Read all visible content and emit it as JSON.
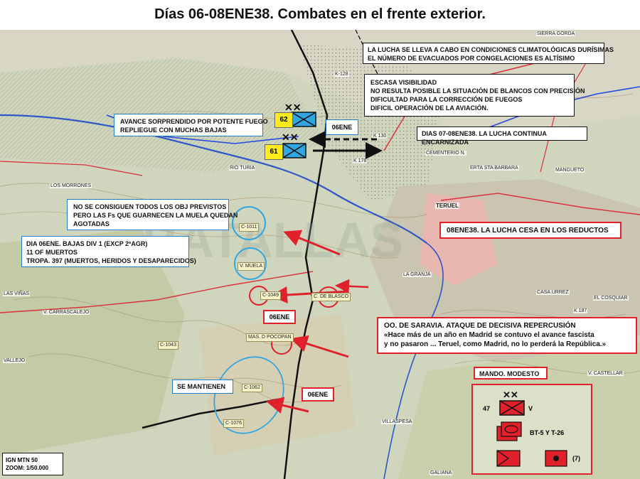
{
  "title": "Días 06-08ENE38. Combates en el frente exterior.",
  "boxes": {
    "climate": [
      "LA LUCHA SE LLEVA A CABO EN CONDICIONES CLIMATOLÓGICAS DURÍSIMAS",
      "EL NÚMERO DE EVACUADOS POR CONGELACIONES ES ALTÍSIMO"
    ],
    "visibility": [
      "ESCASA VISIBILIDAD",
      "NO RESULTA POSIBLE LA SITUACIÓN DE BLANCOS CON PRECISIÓN",
      "DIFICULTAD PARA LA CORRECCIÓN DE FUEGOS",
      "DIFICIL OPERACIÓN DE LA AVIACIÓN."
    ],
    "advance": [
      "AVANCE SORPRENDIDO POR POTENTE FUEGO",
      "REPLIEGUE CON MUCHAS BAJAS"
    ],
    "days_0708": "DIAS 07-08ENE38. LA LUCHA CONTINUA ENCARNIZADA",
    "objectives": [
      "NO SE CONSIGUEN TODOS LOS OBJ PREVISTOS",
      "PERO LAS Fs QUE GUARNECEN LA MUELA QUEDAN",
      "  AGOTADAS"
    ],
    "casualties": [
      "DIA 06ENE. BAJAS DIV 1 (EXCP  2ºAGR)",
      "11 OF MUERTOS",
      "TROPA. 397 (MUERTOS, HERIDOS Y DESAPARECIDOS)"
    ],
    "cease": "08ENE38. LA LUCHA CESA EN LOS REDUCTOS",
    "saravia": [
      "OO. DE SARAVIA. ATAQUE DE DECISIVA REPERCUSIÓN",
      "«Hace más de un año en Madrid se contuvo el avance fascista",
      "y no pasaron ... Teruel, como Madrid, no lo perderá  la República.»"
    ],
    "hold": "SE MANTIENEN",
    "date_06ene_top": "06ENE",
    "date_06ene_mid": "06ENE",
    "date_06ene_low": "06ENE",
    "command": "MANDO. MODESTO"
  },
  "units": {
    "u62": "62",
    "u61": "61"
  },
  "positions": {
    "c1011": "C-1011",
    "muela": "V. MUELA",
    "c1049": "C-1049",
    "blasco": "C. DE BLASCO",
    "pocopan": "MAS. D POCOPAN",
    "c1062": "C-1062",
    "c1076": "C-1076",
    "c1043": "C-1043"
  },
  "map_labels": {
    "teruel": "TERUEL",
    "granja": "LA GRANJA",
    "cementerio": "CEMENTERIO N.",
    "k178": "K 178",
    "k128": "K-128",
    "k130": "K 130",
    "rio_turia": "RIO TURIA",
    "morrones": "LOS MORRONES",
    "casa_urrez": "CASA URREZ",
    "cosquilla": "EL COSQUIAR",
    "carrascalejo": "V. CARRASCALEJO",
    "castellar": "V. CASTELLAR",
    "villaspesa": "VILLASPESA",
    "galiana": "GALIANA",
    "sierra_gorda": "SIERRA GORDA",
    "ermita": "ERTA STA BARBARA",
    "vallejo": "VALLEJO",
    "las_viñas": "LAS VIÑAS",
    "manguieto": "MANGUETO",
    "k187": "K 187"
  },
  "legend": {
    "u47": "47",
    "v": "V",
    "tanks": "BT-5 Y T-26",
    "count": "(7)"
  },
  "scale": [
    "IGN MTN 50",
    "ZOOM: 1/50.000"
  ],
  "colors": {
    "republican_red": "#e0202a",
    "nationalist_blue": "#1e7fd0",
    "position_circle": "#32a6e0",
    "tag_yellow": "#ffeb1a"
  }
}
